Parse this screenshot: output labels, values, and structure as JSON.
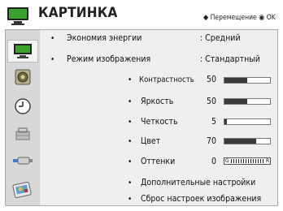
{
  "header": {
    "title": "КАРТИНКА",
    "hint": "Перемещение",
    "ok_label": "OK",
    "nav_glyph": "◆",
    "ok_glyph": "◉"
  },
  "sidebar": {
    "items": [
      {
        "icon": "picture-icon",
        "selected": true
      },
      {
        "icon": "speaker-icon",
        "selected": false
      },
      {
        "icon": "clock-icon",
        "selected": false
      },
      {
        "icon": "lock-icon",
        "selected": false
      },
      {
        "icon": "input-connector-icon",
        "selected": false
      },
      {
        "icon": "settings-icon",
        "selected": false
      }
    ]
  },
  "menu": {
    "energy_saving": {
      "label": "Экономия энергии",
      "value": ": Средний"
    },
    "picture_mode": {
      "label": "Режим изображения",
      "value": ": Стандартный"
    },
    "contrast": {
      "label": "Контрастность",
      "value": 50,
      "fill": 0.5
    },
    "brightness": {
      "label": "Яркость",
      "value": 50,
      "fill": 0.5
    },
    "sharpness": {
      "label": "Четкость",
      "value": 5,
      "fill": 0.06
    },
    "color": {
      "label": "Цвет",
      "value": 70,
      "fill": 0.7
    },
    "tint": {
      "label": "Оттенки",
      "value": 0,
      "left_mark": "G",
      "right_mark": "R"
    },
    "advanced": {
      "label": "Дополнительные настройки"
    },
    "reset": {
      "label": "Сброс настроек изображения"
    }
  },
  "colors": {
    "screen_green": "#3aa32d",
    "fill_dark": "#3a3a3a"
  }
}
